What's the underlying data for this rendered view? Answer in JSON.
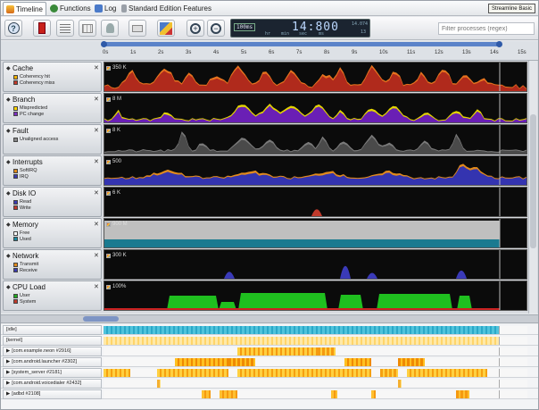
{
  "tabs": [
    {
      "label": "Timeline",
      "active": true,
      "icon": "timeline-icon"
    },
    {
      "label": "Functions",
      "active": false,
      "icon": "functions-icon"
    },
    {
      "label": "Log",
      "active": false,
      "icon": "log-icon"
    },
    {
      "label": "Standard Edition Features",
      "active": false,
      "icon": "features-icon"
    }
  ],
  "edition_badge": "Streamline Basic",
  "toolbar": {
    "buttons": [
      "help-icon",
      "record-icon",
      "list-icon",
      "table-icon",
      "pin-icon",
      "bookmark-icon",
      "marker-icon",
      "zoom-in-icon",
      "zoom-out-icon"
    ],
    "lcd": {
      "resolution": "100ms",
      "time": "14:800",
      "units": [
        "hr",
        "min",
        "sec",
        "ms"
      ],
      "right_top": "14.074",
      "right_bottom": "13"
    },
    "filter_placeholder": "Filter processes (regex)"
  },
  "ruler": {
    "ticks": [
      "0s",
      "1s",
      "2s",
      "3s",
      "4s",
      "5s",
      "6s",
      "7s",
      "8s",
      "9s",
      "10s",
      "11s",
      "12s",
      "13s",
      "14s",
      "15s"
    ]
  },
  "series": [
    {
      "title": "Cache",
      "max": "350 K",
      "legend": [
        {
          "label": "Coherency hit",
          "color": "#f0b000"
        },
        {
          "label": "Coherency miss",
          "color": "#c0392b"
        }
      ],
      "type": "area",
      "colors": [
        "#b02a1c",
        "#e6731e"
      ]
    },
    {
      "title": "Branch",
      "max": "8 M",
      "legend": [
        {
          "label": "Mispredicted",
          "color": "#ffd500"
        },
        {
          "label": "PC change",
          "color": "#7b2fbf"
        }
      ],
      "type": "area",
      "colors": [
        "#6a1fb5",
        "#e3d400"
      ]
    },
    {
      "title": "Fault",
      "max": "8 K",
      "legend": [
        {
          "label": "Unaligned access",
          "color": "#888888"
        }
      ],
      "type": "area",
      "colors": [
        "#4a4a4a",
        "#7a7a7a"
      ]
    },
    {
      "title": "Interrupts",
      "max": "500",
      "legend": [
        {
          "label": "SoftIRQ",
          "color": "#e08a1c"
        },
        {
          "label": "IRQ",
          "color": "#3a3ab0"
        }
      ],
      "type": "area",
      "colors": [
        "#3434b0",
        "#e08a1c"
      ]
    },
    {
      "title": "Disk IO",
      "max": "6 K",
      "legend": [
        {
          "label": "Read",
          "color": "#3a3ab0"
        },
        {
          "label": "Write",
          "color": "#c0392b"
        }
      ],
      "type": "spike",
      "colors": [
        "#c0392b"
      ]
    },
    {
      "title": "Memory",
      "max": "900 M",
      "legend": [
        {
          "label": "Free",
          "color": "#ffffff"
        },
        {
          "label": "Used",
          "color": "#1a8aa0"
        }
      ],
      "type": "memory",
      "colors": [
        "#bfbfbf",
        "#1a7a90"
      ]
    },
    {
      "title": "Network",
      "max": "300 K",
      "legend": [
        {
          "label": "Transmit",
          "color": "#e08a1c"
        },
        {
          "label": "Receive",
          "color": "#3a3ab0"
        }
      ],
      "type": "spike",
      "colors": [
        "#3a3ab8"
      ]
    },
    {
      "title": "CPU Load",
      "max": "100%",
      "legend": [
        {
          "label": "User",
          "color": "#22aa22"
        },
        {
          "label": "System",
          "color": "#c0392b"
        }
      ],
      "type": "cpu",
      "colors": [
        "#1fbf1f"
      ]
    }
  ],
  "processes": [
    "[idle]",
    "[kernel]",
    "[com.example.neon #2916]",
    "[com.android.launcher #2302]",
    "[system_server #2181]",
    "[com.android.voicedialer #2432]",
    "[adbd #2108]"
  ]
}
